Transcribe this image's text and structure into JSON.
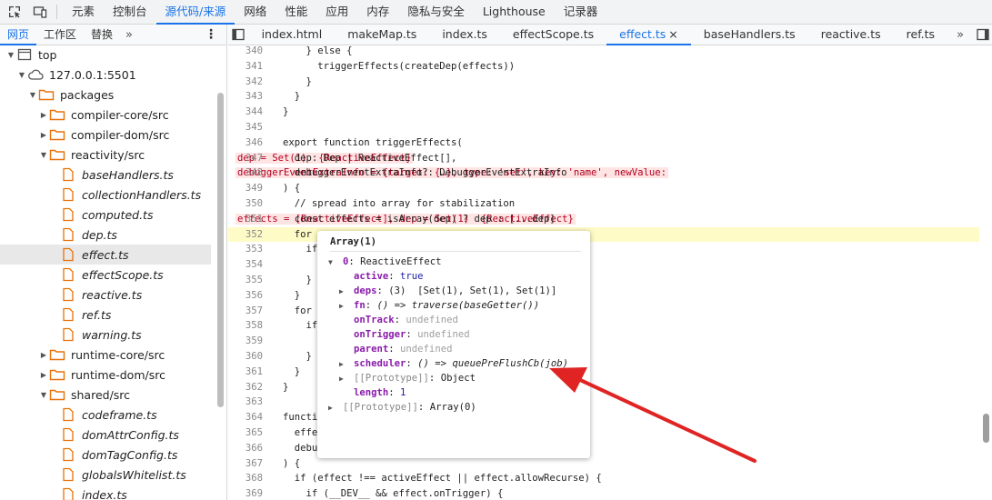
{
  "toolbar": {
    "tabs": [
      {
        "label": "元素",
        "active": false
      },
      {
        "label": "控制台",
        "active": false
      },
      {
        "label": "源代码/来源",
        "active": true
      },
      {
        "label": "网络",
        "active": false
      },
      {
        "label": "性能",
        "active": false
      },
      {
        "label": "应用",
        "active": false
      },
      {
        "label": "内存",
        "active": false
      },
      {
        "label": "隐私与安全",
        "active": false
      },
      {
        "label": "Lighthouse",
        "active": false
      },
      {
        "label": "记录器",
        "active": false
      }
    ]
  },
  "navigator": {
    "tabs": [
      {
        "label": "网页",
        "active": true
      },
      {
        "label": "工作区",
        "active": false
      },
      {
        "label": "替换",
        "active": false
      }
    ],
    "more": "»",
    "tree": [
      {
        "label": "top",
        "type": "frame",
        "depth": 0,
        "expanded": true
      },
      {
        "label": "127.0.0.1:5501",
        "type": "cloud",
        "depth": 1,
        "expanded": true
      },
      {
        "label": "packages",
        "type": "folder",
        "depth": 2,
        "expanded": true
      },
      {
        "label": "compiler-core/src",
        "type": "folder",
        "depth": 3,
        "expanded": false
      },
      {
        "label": "compiler-dom/src",
        "type": "folder",
        "depth": 3,
        "expanded": false
      },
      {
        "label": "reactivity/src",
        "type": "folder",
        "depth": 3,
        "expanded": true
      },
      {
        "label": "baseHandlers.ts",
        "type": "file",
        "depth": 4
      },
      {
        "label": "collectionHandlers.ts",
        "type": "file",
        "depth": 4
      },
      {
        "label": "computed.ts",
        "type": "file",
        "depth": 4
      },
      {
        "label": "dep.ts",
        "type": "file",
        "depth": 4
      },
      {
        "label": "effect.ts",
        "type": "file",
        "depth": 4,
        "selected": true
      },
      {
        "label": "effectScope.ts",
        "type": "file",
        "depth": 4
      },
      {
        "label": "reactive.ts",
        "type": "file",
        "depth": 4
      },
      {
        "label": "ref.ts",
        "type": "file",
        "depth": 4
      },
      {
        "label": "warning.ts",
        "type": "file",
        "depth": 4
      },
      {
        "label": "runtime-core/src",
        "type": "folder",
        "depth": 3,
        "expanded": false
      },
      {
        "label": "runtime-dom/src",
        "type": "folder",
        "depth": 3,
        "expanded": false
      },
      {
        "label": "shared/src",
        "type": "folder",
        "depth": 3,
        "expanded": true
      },
      {
        "label": "codeframe.ts",
        "type": "file",
        "depth": 4
      },
      {
        "label": "domAttrConfig.ts",
        "type": "file",
        "depth": 4
      },
      {
        "label": "domTagConfig.ts",
        "type": "file",
        "depth": 4
      },
      {
        "label": "globalsWhitelist.ts",
        "type": "file",
        "depth": 4
      },
      {
        "label": "index.ts",
        "type": "file",
        "depth": 4
      }
    ]
  },
  "editor": {
    "file_tabs": [
      {
        "label": "index.html",
        "active": false
      },
      {
        "label": "makeMap.ts",
        "active": false
      },
      {
        "label": "index.ts",
        "active": false
      },
      {
        "label": "effectScope.ts",
        "active": false
      },
      {
        "label": "effect.ts",
        "active": true,
        "close": "×"
      },
      {
        "label": "baseHandlers.ts",
        "active": false
      },
      {
        "label": "reactive.ts",
        "active": false
      },
      {
        "label": "ref.ts",
        "active": false
      }
    ],
    "more": "»",
    "lines": [
      {
        "n": "340",
        "code": "    } else {"
      },
      {
        "n": "341",
        "code": "      triggerEffects(createDep(effects))"
      },
      {
        "n": "342",
        "code": "    }"
      },
      {
        "n": "343",
        "code": "  }"
      },
      {
        "n": "344",
        "code": "}"
      },
      {
        "n": "345",
        "code": ""
      },
      {
        "n": "346",
        "code": "export function triggerEffects("
      },
      {
        "n": "347",
        "code": "  dep: Dep | ReactiveEffect[],",
        "inline": "dep = Set(1)  {ReactiveEffect}"
      },
      {
        "n": "348",
        "code": "  debuggerEventExtraInfo?: DebuggerEventExtraInfo",
        "inline": "debuggerEventExtraInfo = {target: {…}, type: 'set', key: 'name', newValue:"
      },
      {
        "n": "349",
        "code": ") {"
      },
      {
        "n": "350",
        "code": "  // spread into array for stabilization"
      },
      {
        "n": "351",
        "code": "  const effects = isArray(dep) ? dep : [...dep]",
        "inline": "effects = [ReactiveEffect], dep = Set(1)  {ReactiveEffect}"
      },
      {
        "n": "352",
        "code": "  for",
        "exec": true
      },
      {
        "n": "353",
        "code": "    if"
      },
      {
        "n": "354",
        "code": "      "
      },
      {
        "n": "355",
        "code": "    }"
      },
      {
        "n": "356",
        "code": "  }"
      },
      {
        "n": "357",
        "code": "  for"
      },
      {
        "n": "358",
        "code": "    if"
      },
      {
        "n": "359",
        "code": "      "
      },
      {
        "n": "360",
        "code": "    }"
      },
      {
        "n": "361",
        "code": "  }"
      },
      {
        "n": "362",
        "code": "}"
      },
      {
        "n": "363",
        "code": ""
      },
      {
        "n": "364",
        "code": "functi"
      },
      {
        "n": "365",
        "code": "  effe"
      },
      {
        "n": "366",
        "code": "  debu"
      },
      {
        "n": "367",
        "code": ") {"
      },
      {
        "n": "368",
        "code": "  if (effect !== activeEffect || effect.allowRecurse) {"
      },
      {
        "n": "369",
        "code": "    if (__DEV__ && effect.onTrigger) {"
      }
    ]
  },
  "popover": {
    "title": "Array(1)",
    "rows": [
      {
        "indent": 0,
        "tri": "▼",
        "key": "0",
        "sep": ": ",
        "value": "ReactiveEffect",
        "vclass": ""
      },
      {
        "indent": 1,
        "tri": "",
        "key": "active",
        "sep": ": ",
        "value": "true",
        "vclass": "pv-bool"
      },
      {
        "indent": 1,
        "tri": "▶",
        "key": "deps",
        "sep": ": ",
        "value": "(3)  [Set(1), Set(1), Set(1)]",
        "vclass": ""
      },
      {
        "indent": 1,
        "tri": "▶",
        "key": "fn",
        "sep": ": ",
        "value": "() => traverse(baseGetter())",
        "vclass": "pv-ital"
      },
      {
        "indent": 1,
        "tri": "",
        "key": "onTrack",
        "sep": ": ",
        "value": "undefined",
        "vclass": "pv-undef"
      },
      {
        "indent": 1,
        "tri": "",
        "key": "onTrigger",
        "sep": ": ",
        "value": "undefined",
        "vclass": "pv-undef"
      },
      {
        "indent": 1,
        "tri": "",
        "key": "parent",
        "sep": ": ",
        "value": "undefined",
        "vclass": "pv-undef"
      },
      {
        "indent": 1,
        "tri": "▶",
        "key": "scheduler",
        "sep": ": ",
        "value": "() => queuePreFlushCb(job)",
        "vclass": "pv-ital"
      },
      {
        "indent": 1,
        "tri": "▶",
        "key": "[[Prototype]]",
        "sep": ": ",
        "value": "Object",
        "vclass": "",
        "proto": true
      },
      {
        "indent": 0,
        "tri": "",
        "key": "length",
        "sep": ": ",
        "value": "1",
        "vclass": "pv-num",
        "pad": true
      },
      {
        "indent": 0,
        "tri": "▶",
        "key": "[[Prototype]]",
        "sep": ": ",
        "value": "Array(0)",
        "vclass": "",
        "proto": true
      }
    ]
  },
  "colors": {
    "accent": "#1a73e8",
    "arrow": "#e02424",
    "exec_line": "#fffbc7",
    "inline_value_bg": "#ffe4e4",
    "folder": "#f57c00"
  }
}
